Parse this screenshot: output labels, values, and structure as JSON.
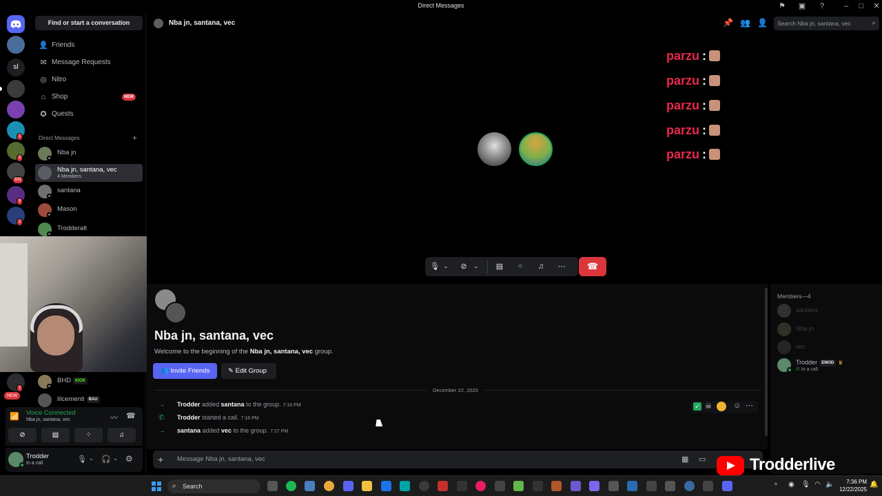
{
  "window": {
    "title": "Direct Messages"
  },
  "servers": {
    "sl_label": "sl",
    "badges": [
      "1",
      "3",
      "531",
      "9",
      "2"
    ],
    "new_badge": "NEW",
    "new_badge_count": "1"
  },
  "sidebar": {
    "find_label": "Find or start a conversation",
    "nav": [
      {
        "label": "Friends",
        "icon": "friends-icon"
      },
      {
        "label": "Message Requests",
        "icon": "envelope-icon"
      },
      {
        "label": "Nitro",
        "icon": "nitro-icon"
      },
      {
        "label": "Shop",
        "icon": "shop-icon",
        "badge": "NEW"
      },
      {
        "label": "Quests",
        "icon": "compass-icon"
      }
    ],
    "dm_header": "Direct Messages",
    "dms": [
      {
        "name": "Nba jn"
      },
      {
        "name": "Nba jn, santana, vec",
        "sub": "4 Members"
      },
      {
        "name": "santana"
      },
      {
        "name": "Mason"
      },
      {
        "name": "Trodderalt"
      },
      {
        "name": "BHD",
        "tag": "KICK"
      },
      {
        "name": "lilcementi",
        "tag": "BAU"
      }
    ]
  },
  "voice": {
    "status": "Voice Connected",
    "channel": "Nba jn, santana, vec"
  },
  "user": {
    "name": "Trodder",
    "status": "In a call"
  },
  "header": {
    "channel_name": "Nba jn, santana, vec",
    "search_placeholder": "Search Nba jn, santana, vec"
  },
  "call": {
    "overlay_lines": [
      {
        "name": "parzu",
        "sep": ":"
      },
      {
        "name": "parzu",
        "sep": ":"
      },
      {
        "name": "parzu",
        "sep": ":"
      },
      {
        "name": "parzu",
        "sep": ":"
      },
      {
        "name": "parzu",
        "sep": ":"
      }
    ]
  },
  "chat": {
    "title": "Nba jn, santana, vec",
    "welcome_prefix": "Welcome to the beginning of the ",
    "welcome_group": "Nba jn, santana, vec",
    "welcome_suffix": " group.",
    "invite_label": "Invite Friends",
    "edit_label": "Edit Group",
    "date_divider": "December 22, 2025",
    "messages": [
      {
        "actor": "Trodder",
        "verb": " added ",
        "target": "santana",
        "rest": " to the group.",
        "time": "7:16 PM"
      },
      {
        "actor": "Trodder",
        "verb": " started a call.",
        "target": "",
        "rest": "",
        "time": "7:16 PM"
      },
      {
        "actor": "santana",
        "verb": " added ",
        "target": "vec",
        "rest": " to the group.",
        "time": "7:27 PM"
      }
    ],
    "composer_placeholder": "Message Nba jn, santana, vec"
  },
  "members": {
    "header": "Members—4",
    "list": [
      {
        "name": "santana"
      },
      {
        "name": "Nba jn"
      },
      {
        "name": "vec"
      },
      {
        "name": "Trodder",
        "tag": "EMOD",
        "status": "In a call"
      }
    ]
  },
  "taskbar": {
    "search_label": "Search",
    "time": "7:36 PM",
    "date": "12/22/2025"
  },
  "stream_overlay": {
    "channel": "Trodderlive"
  },
  "colors": {
    "accent": "#5865f2",
    "danger": "#da373c",
    "online": "#23a55a",
    "overlay_red": "#e8294a"
  }
}
